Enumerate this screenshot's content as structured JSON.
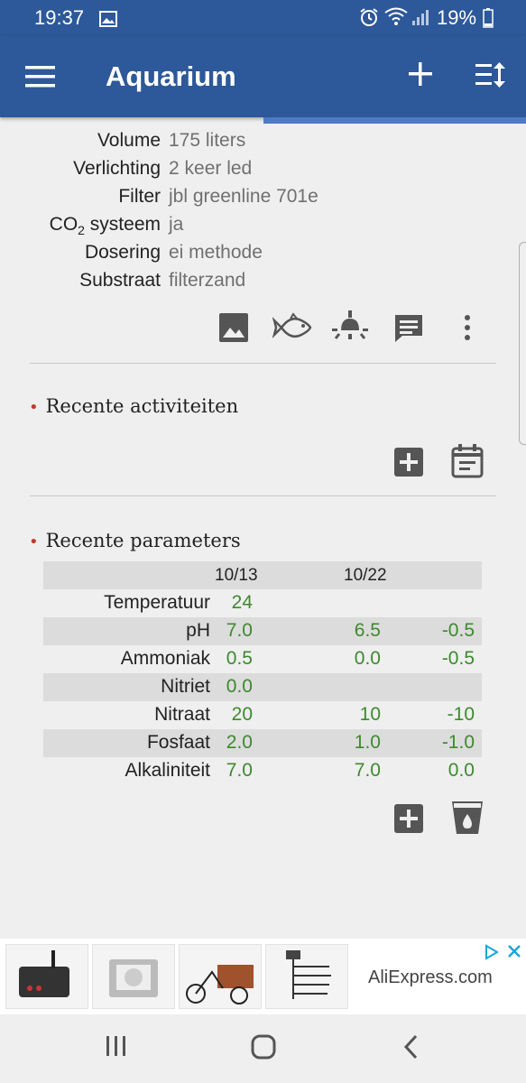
{
  "status": {
    "time": "19:37",
    "battery": "19%"
  },
  "app": {
    "title": "Aquarium"
  },
  "details": [
    {
      "label": "Volume",
      "value": "175 liters"
    },
    {
      "label": "Verlichting",
      "value": "2 keer led"
    },
    {
      "label": "Filter",
      "value": "jbl greenline 701e"
    },
    {
      "label_main": "CO",
      "label_sub": "2",
      "label_rest": " systeem",
      "value": "ja"
    },
    {
      "label": "Dosering",
      "value": "ei methode"
    },
    {
      "label": "Substraat",
      "value": "filterzand"
    }
  ],
  "sections": {
    "activities": {
      "title": "Recente activiteiten"
    },
    "parameters": {
      "title": "Recente parameters"
    }
  },
  "parameters": {
    "dates": [
      "10/13",
      "10/22"
    ],
    "rows": [
      {
        "name": "Temperatuur",
        "v1": "24",
        "v2": "",
        "v3": ""
      },
      {
        "name": "pH",
        "v1": "7.0",
        "v2": "6.5",
        "v3": "-0.5"
      },
      {
        "name": "Ammoniak",
        "v1": "0.5",
        "v2": "0.0",
        "v3": "-0.5"
      },
      {
        "name": "Nitriet",
        "v1": "0.0",
        "v2": "",
        "v3": ""
      },
      {
        "name": "Nitraat",
        "v1": "20",
        "v2": "10",
        "v3": "-10"
      },
      {
        "name": "Fosfaat",
        "v1": "2.0",
        "v2": "1.0",
        "v3": "-1.0"
      },
      {
        "name": "Alkaliniteit",
        "v1": "7.0",
        "v2": "7.0",
        "v3": "0.0"
      }
    ]
  },
  "ad": {
    "text": "AliExpress.com"
  },
  "colors": {
    "primary": "#2d5899",
    "accent": "#4f7ac4",
    "value_green": "#3c8a2d",
    "bullet_red": "#c0392b",
    "icon_gray": "#555555"
  }
}
